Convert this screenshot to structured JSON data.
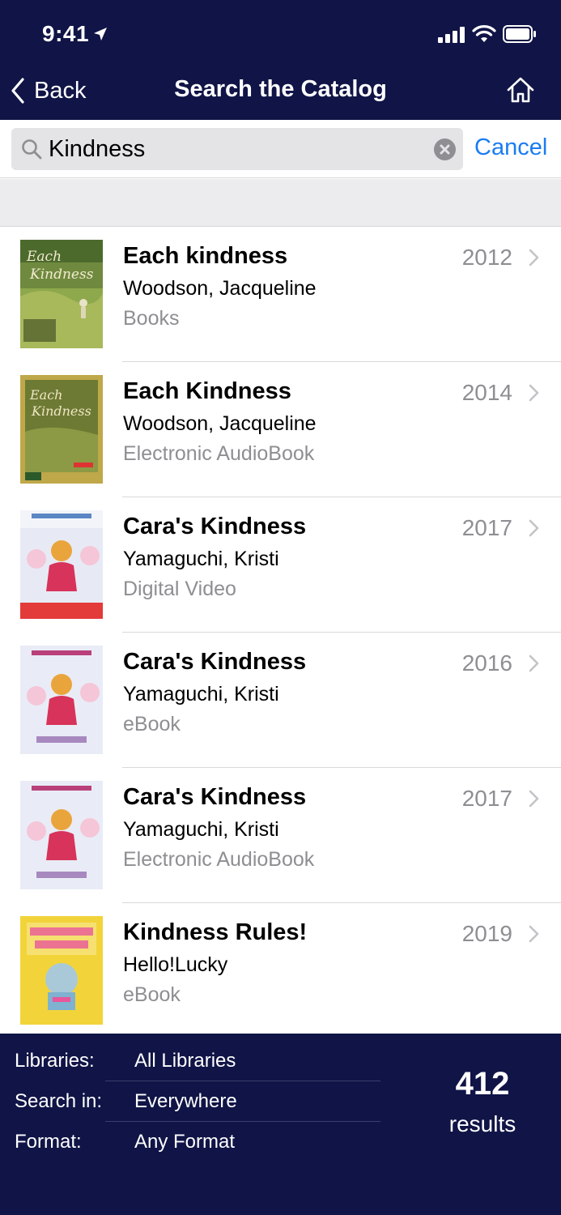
{
  "status_bar": {
    "time": "9:41"
  },
  "nav": {
    "back_label": "Back",
    "title": "Search the Catalog"
  },
  "search": {
    "value": "Kindness",
    "cancel_label": "Cancel"
  },
  "results": [
    {
      "title": "Each kindness",
      "author": "Woodson, Jacqueline",
      "format": "Books",
      "year": "2012"
    },
    {
      "title": "Each Kindness",
      "author": "Woodson, Jacqueline",
      "format": "Electronic AudioBook",
      "year": "2014"
    },
    {
      "title": "Cara's Kindness",
      "author": "Yamaguchi, Kristi",
      "format": "Digital Video",
      "year": "2017"
    },
    {
      "title": "Cara's Kindness",
      "author": "Yamaguchi, Kristi",
      "format": "eBook",
      "year": "2016"
    },
    {
      "title": "Cara's Kindness",
      "author": "Yamaguchi, Kristi",
      "format": "Electronic AudioBook",
      "year": "2017"
    },
    {
      "title": "Kindness Rules!",
      "author": "Hello!Lucky",
      "format": "eBook",
      "year": "2019"
    }
  ],
  "filters": {
    "libraries": {
      "label": "Libraries:",
      "value": "All Libraries"
    },
    "search_in": {
      "label": "Search in:",
      "value": "Everywhere"
    },
    "format": {
      "label": "Format:",
      "value": "Any Format"
    }
  },
  "summary": {
    "count": "412",
    "count_label": "results"
  },
  "colors": {
    "header_bg": "#101446",
    "accent": "#1a7cf3",
    "secondary_text": "#8e8e93"
  }
}
